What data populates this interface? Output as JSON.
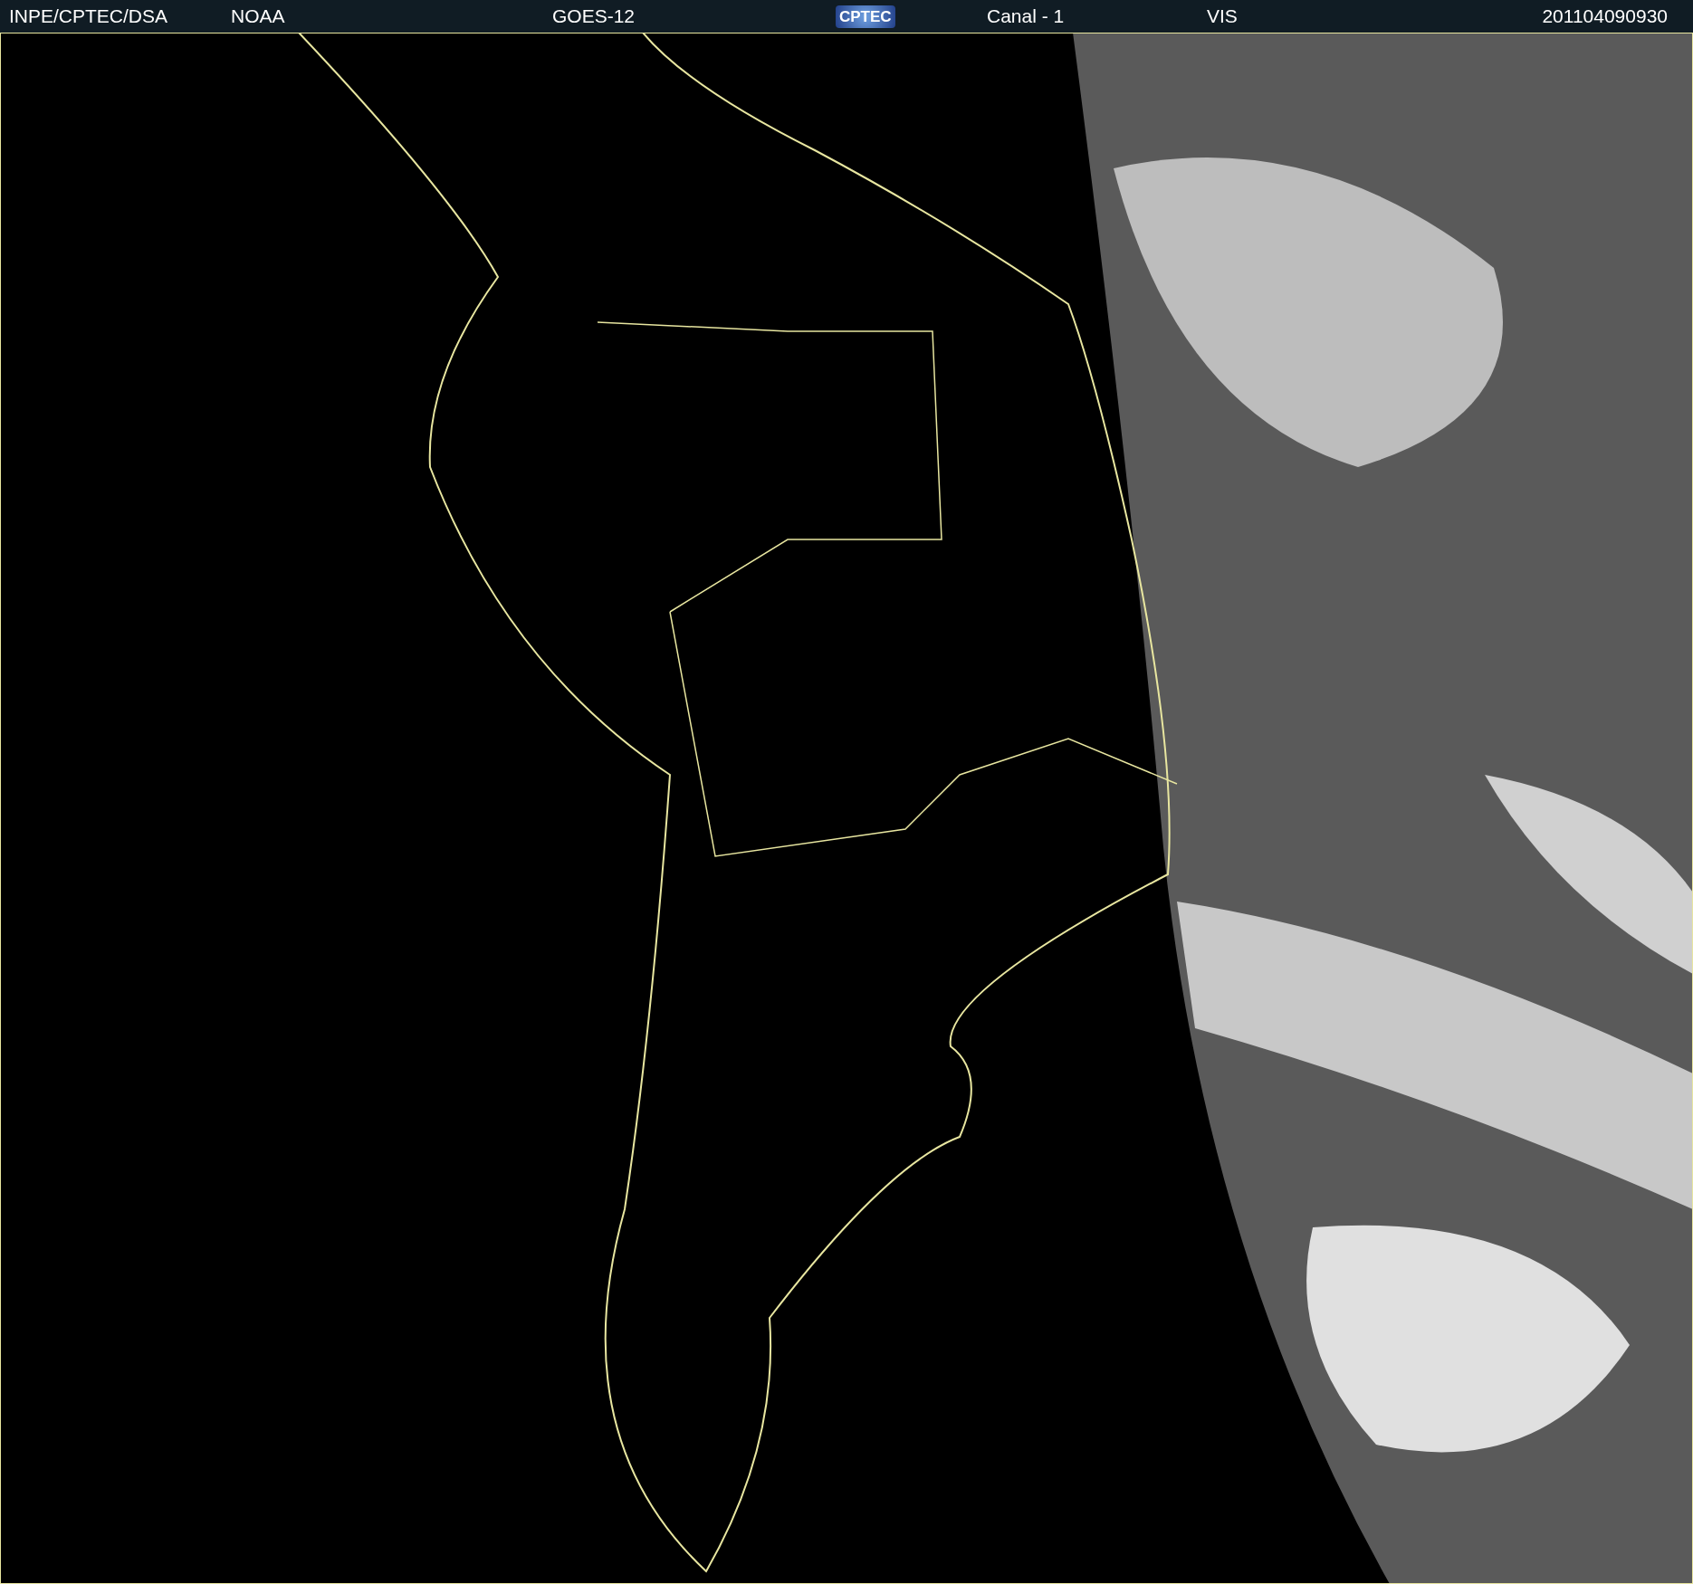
{
  "header": {
    "source": "INPE/CPTEC/DSA",
    "agency": "NOAA",
    "satellite": "GOES-12",
    "logo": "CPTEC",
    "channel": "Canal - 1",
    "band": "VIS",
    "timestamp": "201104090930"
  }
}
